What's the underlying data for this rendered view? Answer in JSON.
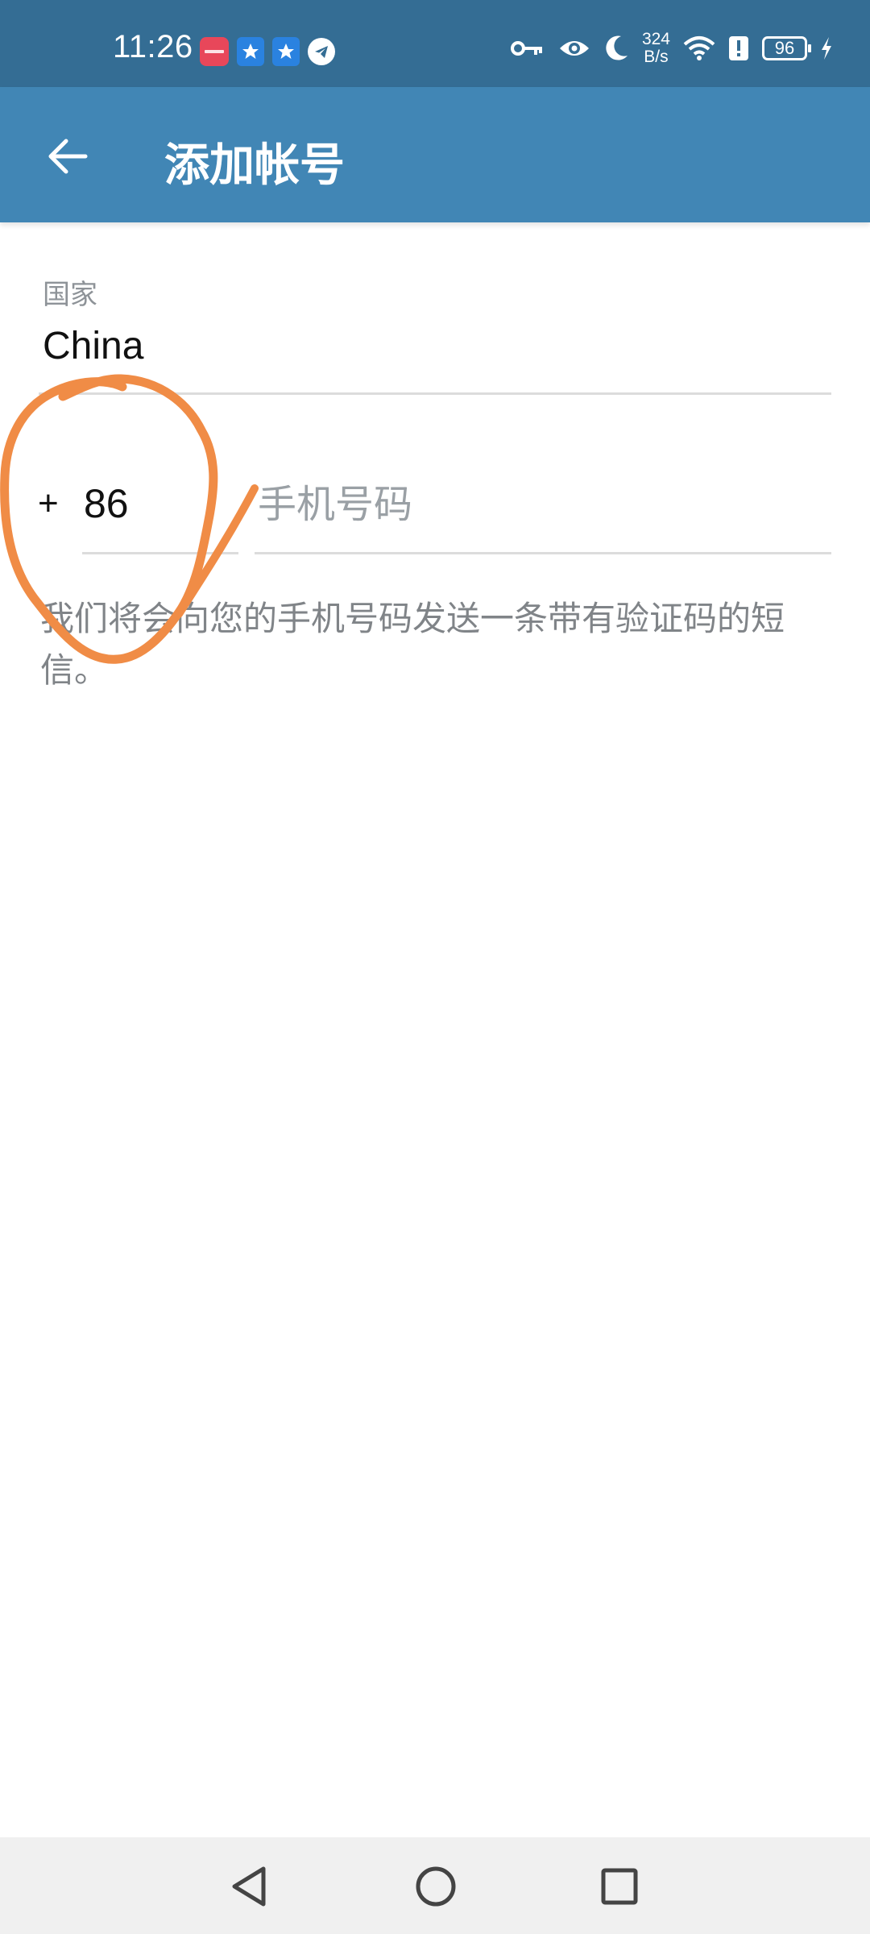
{
  "status_bar": {
    "time": "11:26",
    "net_speed_value": "324",
    "net_speed_unit": "B/s",
    "battery_level": "96",
    "icons": [
      "app-notification-icon",
      "chat-app-icon",
      "chat-app-icon",
      "telegram-icon",
      "key-icon",
      "eye-icon",
      "moon-icon",
      "wifi-icon",
      "alert-icon",
      "battery-icon",
      "charging-icon"
    ]
  },
  "app_bar": {
    "title": "添加帐号",
    "back_icon": "arrow-left-icon"
  },
  "form": {
    "country_label": "国家",
    "country_value": "China",
    "code_prefix": "+",
    "country_code": "86",
    "phone_placeholder": "手机号码",
    "info_text": "我们将会向您的手机号码发送一条带有验证码的短信。"
  },
  "nav_bar": {
    "icons": [
      "back-triangle-icon",
      "home-circle-icon",
      "recents-square-icon"
    ]
  },
  "colors": {
    "status_bar": "#346d94",
    "app_bar": "#4186b5",
    "annotation": "#f08c46",
    "divider": "#dcdcdc",
    "label_gray": "#8e9398"
  }
}
